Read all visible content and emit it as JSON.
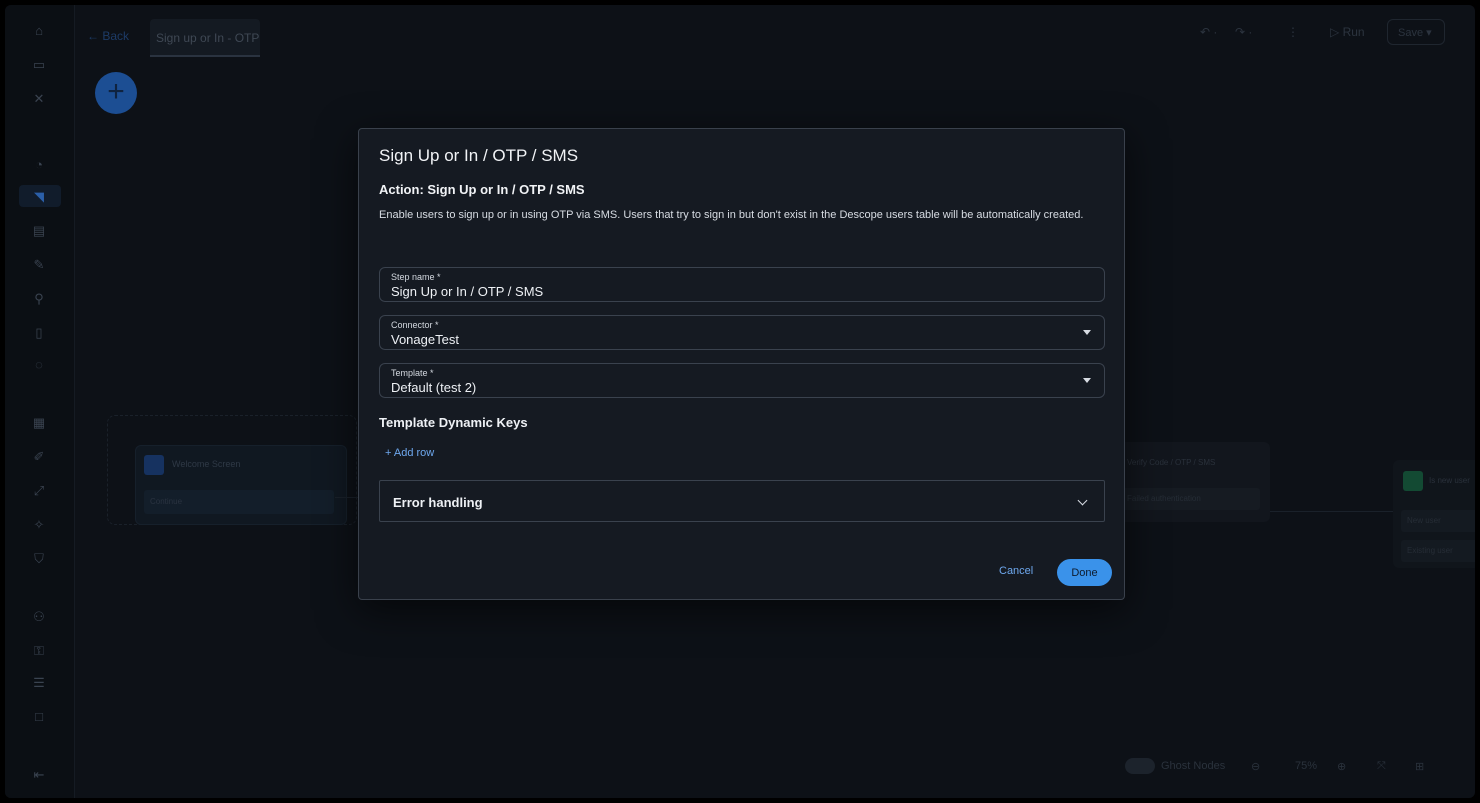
{
  "background": {
    "back_label": "Back",
    "active_tab": "Sign up or In - OTP",
    "top_undo": "undo",
    "top_redo": "redo",
    "run_label": "Run",
    "save_label": "Save",
    "node_welcome_title": "Welcome Screen",
    "node_welcome_row": "Continue",
    "node_verify_title": "Verify Code / OTP / SMS",
    "node_verify_row": "Failed authentication",
    "node_user_title": "Is new user",
    "node_user_row1": "New user",
    "node_user_row2": "Existing user",
    "ghost_nodes_label": "Ghost Nodes",
    "zoom_level": "75%"
  },
  "modal": {
    "title": "Sign Up or In / OTP / SMS",
    "action_title": "Action: Sign Up or In / OTP / SMS",
    "description": "Enable users to sign up or in using OTP via SMS. Users that try to sign in but don't exist in the Descope users table will be automatically created.",
    "step_name": {
      "label": "Step name *",
      "value": "Sign Up or In / OTP / SMS"
    },
    "connector": {
      "label": "Connector *",
      "value": "VonageTest"
    },
    "template": {
      "label": "Template *",
      "value": "Default (test 2)"
    },
    "dynamic_keys_title": "Template Dynamic Keys",
    "add_row_label": "+ Add row",
    "error_handling_label": "Error handling",
    "cancel_label": "Cancel",
    "done_label": "Done"
  },
  "colors": {
    "accent": "#3a92ea",
    "link": "#6ea8ee",
    "modal_bg": "#151a22",
    "page_bg": "#0d1117"
  }
}
